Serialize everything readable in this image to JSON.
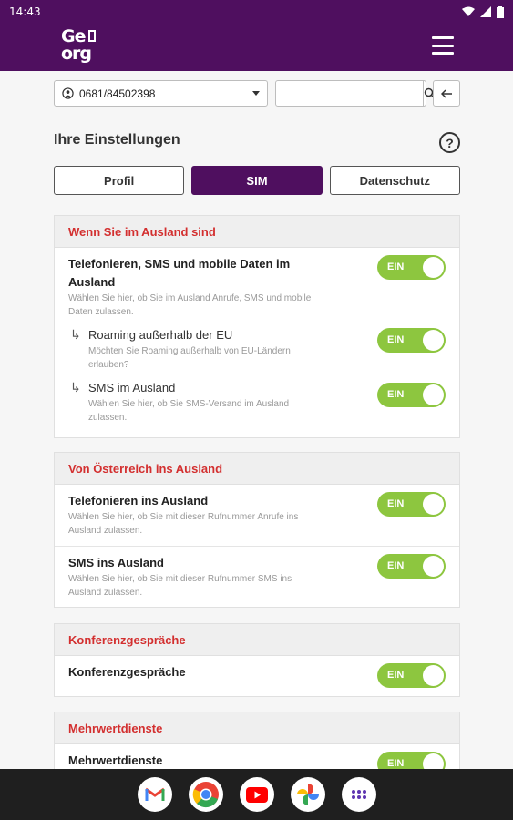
{
  "status": {
    "time": "14:43"
  },
  "app": {
    "logo_line1": "Ge",
    "logo_line2": "org"
  },
  "account": {
    "selected": "0681/84502398"
  },
  "search": {
    "placeholder": ""
  },
  "page": {
    "heading": "Ihre Einstellungen",
    "help": "?"
  },
  "tabs": [
    {
      "label": "Profil",
      "active": false
    },
    {
      "label": "SIM",
      "active": true
    },
    {
      "label": "Datenschutz",
      "active": false
    }
  ],
  "sections": [
    {
      "title": "Wenn Sie im Ausland sind",
      "rows": [
        {
          "title": "Telefonieren, SMS und mobile Daten im Ausland",
          "desc": "Wählen Sie hier, ob Sie im Ausland Anrufe, SMS und mobile Daten zulassen.",
          "toggle": "EIN",
          "subs": [
            {
              "title": "Roaming außerhalb der EU",
              "desc": "Möchten Sie Roaming außerhalb von EU-Ländern erlauben?",
              "toggle": "EIN"
            },
            {
              "title": "SMS im Ausland",
              "desc": "Wählen Sie hier, ob Sie SMS-Versand im Ausland zulassen.",
              "toggle": "EIN"
            }
          ]
        }
      ]
    },
    {
      "title": "Von Österreich ins Ausland",
      "rows": [
        {
          "title": "Telefonieren ins Ausland",
          "desc": "Wählen Sie hier, ob Sie mit dieser Rufnummer Anrufe ins Ausland zulassen.",
          "toggle": "EIN"
        },
        {
          "title": "SMS ins Ausland",
          "desc": "Wählen Sie hier, ob Sie mit dieser Rufnummer SMS ins Ausland zulassen.",
          "toggle": "EIN"
        }
      ]
    },
    {
      "title": "Konferenzgespräche",
      "rows": [
        {
          "title": "Konferenzgespräche",
          "toggle": "EIN"
        }
      ]
    },
    {
      "title": "Mehrwertdienste",
      "rows": [
        {
          "title": "Mehrwertdienste",
          "toggle": "EIN"
        }
      ]
    }
  ],
  "dock": [
    "gmail-icon",
    "chrome-icon",
    "youtube-icon",
    "photos-icon",
    "apps-icon"
  ],
  "colors": {
    "brand": "#4f0f5f",
    "accent": "#d32f2f",
    "toggle_on": "#8dc63f"
  }
}
